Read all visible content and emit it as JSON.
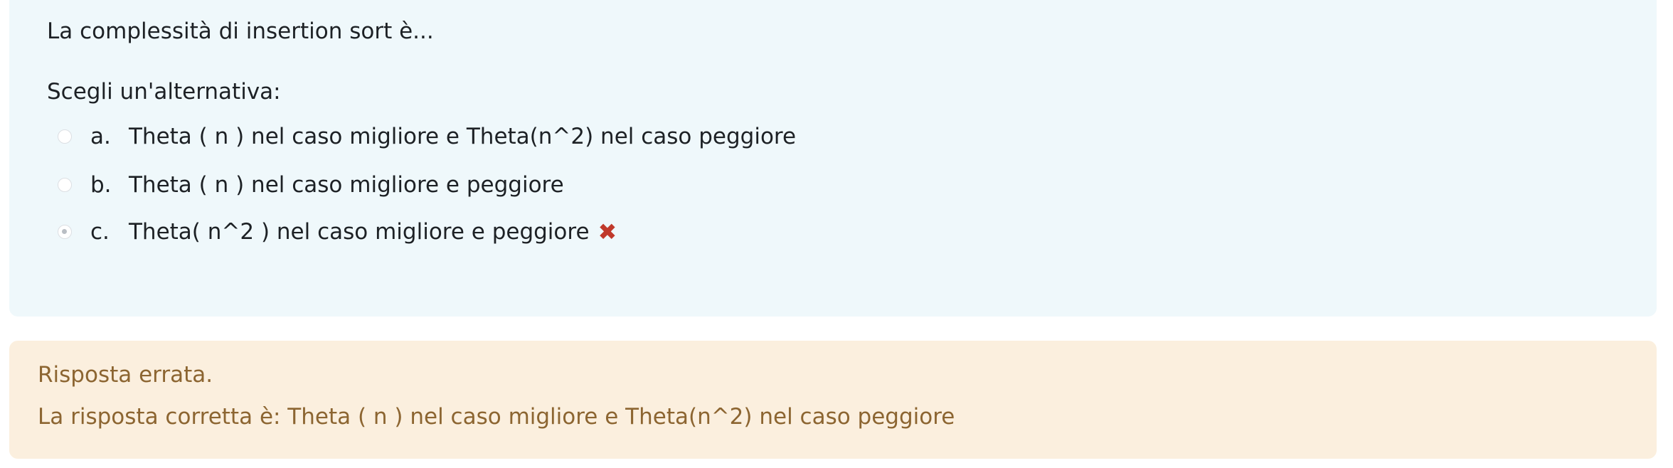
{
  "question": {
    "text": "La complessità di insertion sort è...",
    "prompt": "Scegli un'alternativa:",
    "answers": [
      {
        "letter": "a.",
        "label": "Theta ( n ) nel caso migliore e Theta(n^2) nel caso peggiore",
        "selected": false
      },
      {
        "letter": "b.",
        "label": "Theta ( n ) nel caso migliore e peggiore",
        "selected": false
      },
      {
        "letter": "c.",
        "label": "Theta( n^2 ) nel caso migliore e peggiore",
        "selected": true,
        "mark": "✖"
      }
    ]
  },
  "feedback": {
    "status": "Risposta errata.",
    "right_answer": "La risposta corretta è: Theta ( n ) nel caso migliore e Theta(n^2) nel caso peggiore"
  },
  "icons": {
    "incorrect": "cross-icon",
    "radio": "radio-button"
  },
  "colors": {
    "question_bg": "#eff8fb",
    "feedback_bg": "#fbefde",
    "feedback_text": "#8c6531",
    "incorrect_mark": "#c0392b"
  }
}
